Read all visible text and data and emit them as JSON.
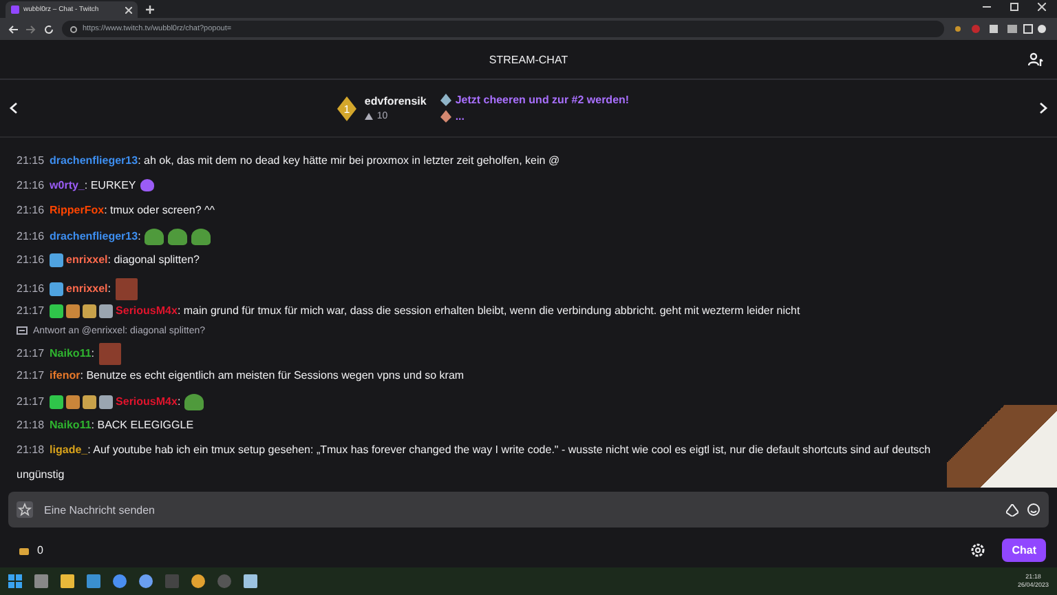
{
  "browser": {
    "tab_title": "wubbl0rz – Chat - Twitch",
    "url": "https://www.twitch.tv/wubbl0rz/chat?popout="
  },
  "header": {
    "title": "STREAM-CHAT"
  },
  "leaderboard": {
    "rank": "1",
    "user": "edvforensik",
    "score": "10",
    "prompt": "Jetzt cheeren und zur #2 werden!",
    "next": "..."
  },
  "messages": [
    {
      "kind": "message",
      "time": "21:15",
      "user": "drachenflieger13",
      "color": "#3d8ef0",
      "text": ": ah ok, das mit dem no dead key hätte mir bei proxmox in letzter zeit geholfen, kein @"
    },
    {
      "kind": "message",
      "time": "21:16",
      "user": "w0rty_",
      "color": "#9b5cf6",
      "text": ": EURKEY",
      "emotes": [
        {
          "kind": "heart"
        }
      ]
    },
    {
      "kind": "message",
      "time": "21:16",
      "user": "RipperFox",
      "color": "#ff4500",
      "text": ": tmux oder screen? ^^"
    },
    {
      "kind": "message",
      "time": "21:16",
      "user": "drachenflieger13",
      "color": "#3d8ef0",
      "text": ":",
      "emotes": [
        {
          "kind": "frog"
        },
        {
          "kind": "frog"
        },
        {
          "kind": "frog"
        }
      ]
    },
    {
      "kind": "message",
      "time": "21:16",
      "user": "enrixxel",
      "color": "#ff6a4d",
      "badges": [
        {
          "kind": "crown"
        }
      ],
      "text": ": diagonal splitten?"
    },
    {
      "kind": "message",
      "time": "21:16",
      "user": "enrixxel",
      "color": "#ff6a4d",
      "badges": [
        {
          "kind": "crown"
        }
      ],
      "text": ":",
      "emotes": [
        {
          "kind": "face"
        }
      ]
    },
    {
      "kind": "message",
      "time": "21:17",
      "user": "SeriousM4x",
      "color": "#e0142c",
      "badges": [
        {
          "kind": "sword"
        },
        {
          "kind": "hand"
        },
        {
          "kind": "box"
        },
        {
          "kind": "globe"
        }
      ],
      "text": ": main grund für tmux für mich war, dass die session erhalten bleibt, wenn die verbindung abbricht. geht mit wezterm leider nicht"
    },
    {
      "kind": "reply",
      "text": "Antwort an @enrixxel: diagonal splitten?"
    },
    {
      "kind": "message",
      "time": "21:17",
      "user": "Naiko11",
      "color": "#2fb52f",
      "text": ":",
      "emotes": [
        {
          "kind": "face"
        }
      ]
    },
    {
      "kind": "message",
      "time": "21:17",
      "user": "ifenor",
      "color": "#e8792a",
      "text": ": Benutze es echt eigentlich am meisten für Sessions wegen vpns und so kram"
    },
    {
      "kind": "message",
      "time": "21:17",
      "user": "SeriousM4x",
      "color": "#e0142c",
      "badges": [
        {
          "kind": "sword"
        },
        {
          "kind": "hand"
        },
        {
          "kind": "box"
        },
        {
          "kind": "globe"
        }
      ],
      "text": ":",
      "emotes": [
        {
          "kind": "frog"
        }
      ]
    },
    {
      "kind": "message",
      "time": "21:18",
      "user": "Naiko11",
      "color": "#2fb52f",
      "text": ": BACK ELEGIGGLE"
    },
    {
      "kind": "message",
      "time": "21:18",
      "user": "ligade_",
      "color": "#d8a21b",
      "text": ": Auf youtube hab ich ein tmux setup gesehen: „Tmux has forever changed the way I write code.\" - wusste nicht wie cool es eigtl ist, nur die default shortcuts sind auf deutsch",
      "more": "ungünstig"
    }
  ],
  "input": {
    "placeholder": "Eine Nachricht senden"
  },
  "footer": {
    "points": "0",
    "send": "Chat"
  },
  "taskbar": {
    "time": "21:18",
    "date": "26/04/2023"
  }
}
